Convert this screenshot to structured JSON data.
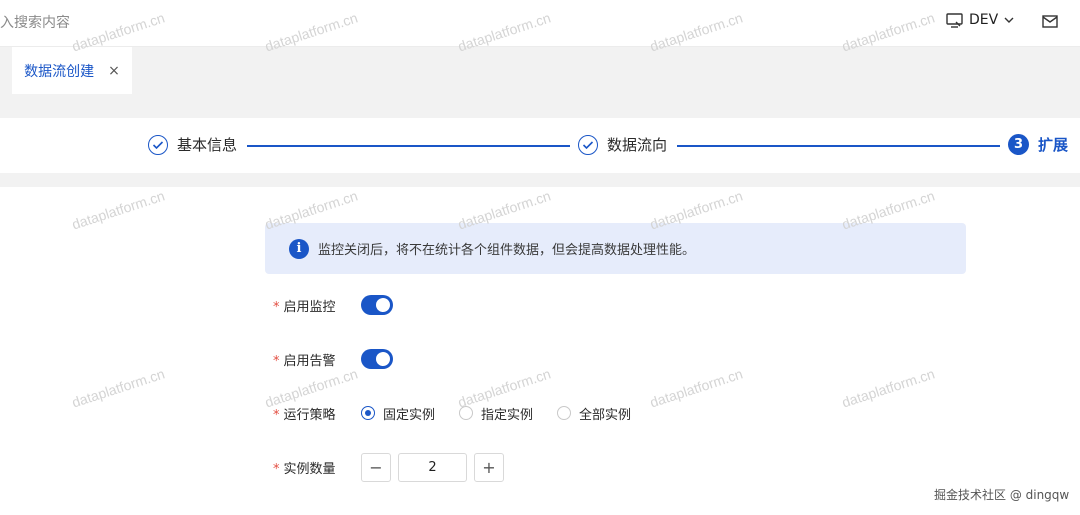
{
  "header": {
    "search_placeholder": "入搜索内容",
    "env_label": "DEV",
    "env_icon": "monitor-icon",
    "mail_icon": "mail-icon"
  },
  "tabs": [
    {
      "label": "数据流创建",
      "close": "×"
    }
  ],
  "steps": [
    {
      "label": "基本信息",
      "state": "done"
    },
    {
      "label": "数据流向",
      "state": "done"
    },
    {
      "label": "扩展",
      "state": "active",
      "number": "3"
    }
  ],
  "alert": {
    "icon": "i",
    "text": "监控关闭后，将不在统计各个组件数据，但会提高数据处理性能。"
  },
  "form": {
    "required_mark": "*",
    "monitor": {
      "label": "启用监控",
      "enabled": true
    },
    "alarm": {
      "label": "启用告警",
      "enabled": true
    },
    "strategy": {
      "label": "运行策略",
      "options": [
        "固定实例",
        "指定实例",
        "全部实例"
      ],
      "selected": "固定实例"
    },
    "instances": {
      "label": "实例数量",
      "value": "2",
      "minus": "−",
      "plus": "+"
    }
  },
  "watermark": "dataplatform.cn",
  "credit": "掘金技术社区 @ dingqw",
  "colors": {
    "primary": "#1a56c7",
    "alert_bg": "#e6ecfb",
    "required": "#e34d41"
  }
}
